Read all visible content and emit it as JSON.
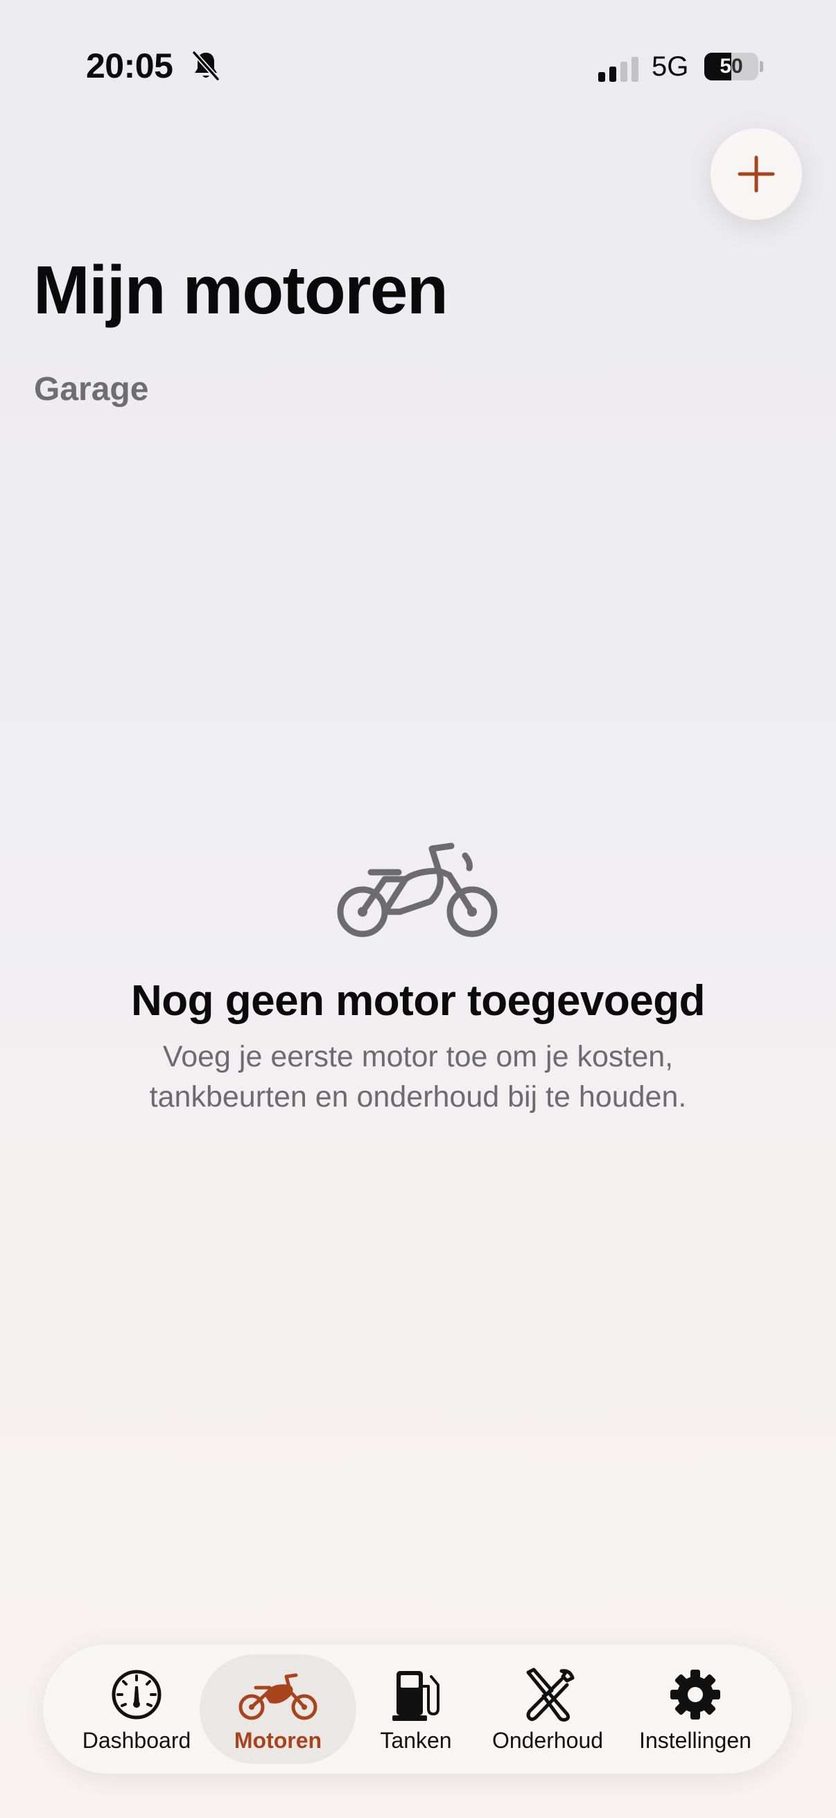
{
  "status_bar": {
    "time": "20:05",
    "network": "5G",
    "battery_level": "50",
    "battery_fraction": 0.5
  },
  "colors": {
    "accent": "#a8441c",
    "icon_gray": "#6c6c70",
    "text_primary": "#0b0b0b"
  },
  "header": {
    "title": "Mijn motoren",
    "subtitle": "Garage"
  },
  "toolbar": {
    "add_icon": "plus-icon"
  },
  "empty_state": {
    "icon": "motorcycle-icon",
    "title": "Nog geen motor toegevoegd",
    "text": "Voeg je eerste motor toe om je kosten, tankbeurten en onderhoud bij te houden."
  },
  "tabs": [
    {
      "label": "Dashboard",
      "icon": "speedometer-icon",
      "active": false
    },
    {
      "label": "Motoren",
      "icon": "motorcycle-icon",
      "active": true
    },
    {
      "label": "Tanken",
      "icon": "fuel-pump-icon",
      "active": false
    },
    {
      "label": "Onderhoud",
      "icon": "wrench-screwdriver-icon",
      "active": false
    },
    {
      "label": "Instellingen",
      "icon": "gear-icon",
      "active": false
    }
  ]
}
